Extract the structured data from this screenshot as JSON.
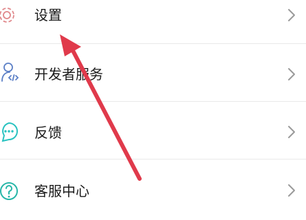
{
  "menu": {
    "items": [
      {
        "label": "设置",
        "icon": "gear-icon"
      },
      {
        "label": "开发者服务",
        "icon": "developer-icon"
      },
      {
        "label": "反馈",
        "icon": "feedback-icon"
      },
      {
        "label": "客服中心",
        "icon": "help-icon"
      }
    ]
  },
  "colors": {
    "settings_icon": "#e0878a",
    "developer_icon": "#5b7fc6",
    "feedback_icon": "#29c2c0",
    "help_icon": "#27b6a8",
    "arrow": "#e03a4b",
    "chevron": "#9a9a9a"
  }
}
